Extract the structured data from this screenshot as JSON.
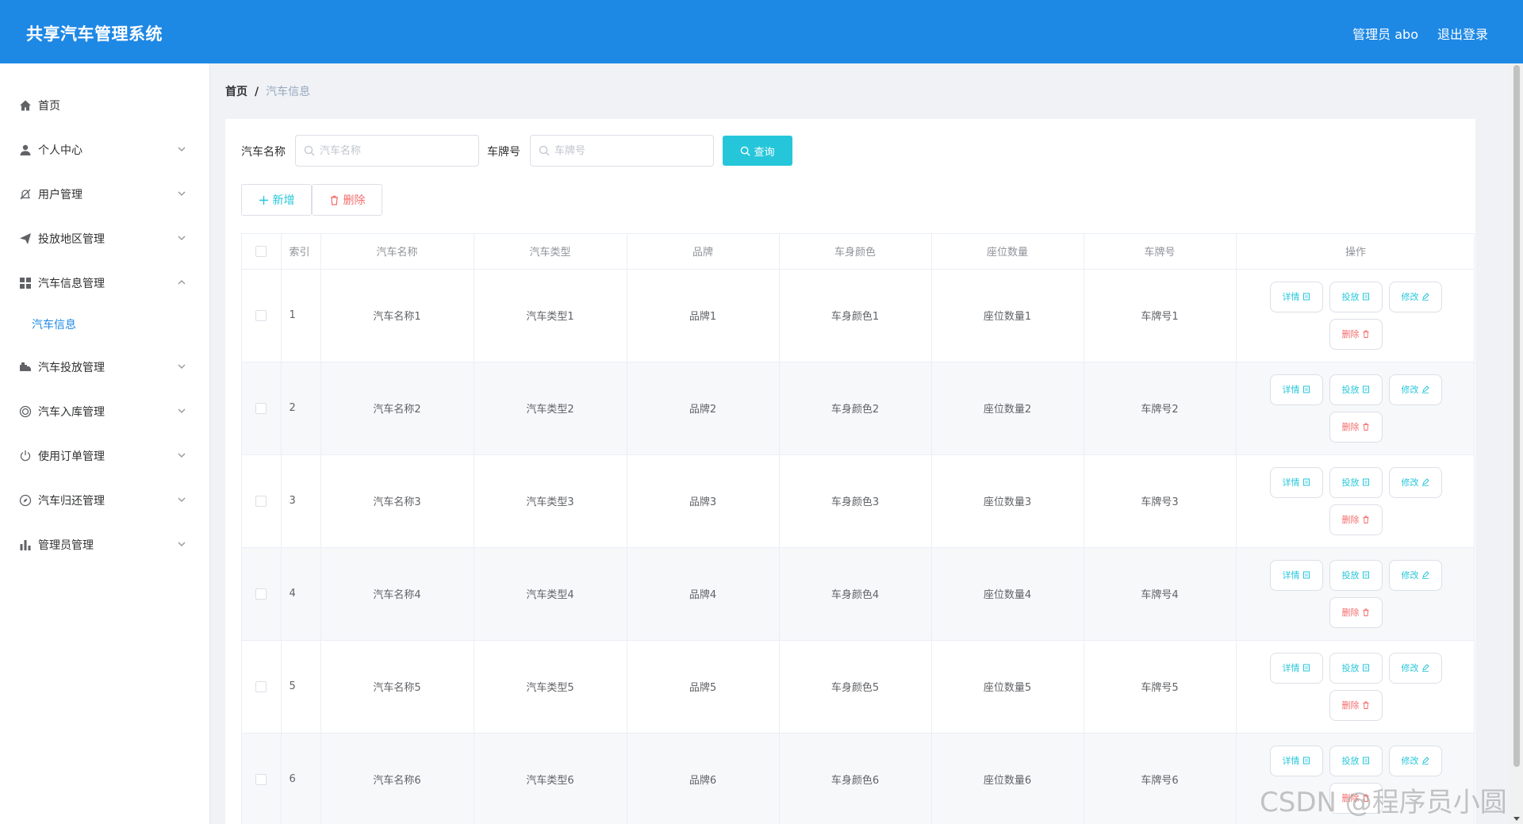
{
  "header": {
    "title": "共享汽车管理系统",
    "user": "管理员 abo",
    "logout": "退出登录"
  },
  "sidebar": {
    "items": [
      {
        "label": "首页",
        "icon": "home-icon",
        "expandable": false
      },
      {
        "label": "个人中心",
        "icon": "user-icon",
        "expandable": true
      },
      {
        "label": "用户管理",
        "icon": "bell-off-icon",
        "expandable": true
      },
      {
        "label": "投放地区管理",
        "icon": "send-icon",
        "expandable": true
      },
      {
        "label": "汽车信息管理",
        "icon": "grid-icon",
        "expandable": true,
        "expanded": true,
        "children": [
          "汽车信息"
        ]
      },
      {
        "label": "汽车投放管理",
        "icon": "truck-icon",
        "expandable": true
      },
      {
        "label": "汽车入库管理",
        "icon": "coin-icon",
        "expandable": true
      },
      {
        "label": "使用订单管理",
        "icon": "power-icon",
        "expandable": true
      },
      {
        "label": "汽车归还管理",
        "icon": "compass-icon",
        "expandable": true
      },
      {
        "label": "管理员管理",
        "icon": "bar-chart-icon",
        "expandable": true
      }
    ]
  },
  "breadcrumb": {
    "home": "首页",
    "separator": "/",
    "current": "汽车信息"
  },
  "search": {
    "name_label": "汽车名称",
    "name_placeholder": "汽车名称",
    "plate_label": "车牌号",
    "plate_placeholder": "车牌号",
    "query_button": "查询"
  },
  "toolbar": {
    "add_label": "新增",
    "delete_label": "删除"
  },
  "table": {
    "columns": [
      "索引",
      "汽车名称",
      "汽车类型",
      "品牌",
      "车身颜色",
      "座位数量",
      "车牌号",
      "操作"
    ],
    "actions": {
      "detail": "详情",
      "deploy": "投放",
      "edit": "修改",
      "delete": "删除"
    },
    "rows": [
      {
        "index": "1",
        "name": "汽车名称1",
        "type": "汽车类型1",
        "brand": "品牌1",
        "color": "车身颜色1",
        "seats": "座位数量1",
        "plate": "车牌号1"
      },
      {
        "index": "2",
        "name": "汽车名称2",
        "type": "汽车类型2",
        "brand": "品牌2",
        "color": "车身颜色2",
        "seats": "座位数量2",
        "plate": "车牌号2"
      },
      {
        "index": "3",
        "name": "汽车名称3",
        "type": "汽车类型3",
        "brand": "品牌3",
        "color": "车身颜色3",
        "seats": "座位数量3",
        "plate": "车牌号3"
      },
      {
        "index": "4",
        "name": "汽车名称4",
        "type": "汽车类型4",
        "brand": "品牌4",
        "color": "车身颜色4",
        "seats": "座位数量4",
        "plate": "车牌号4"
      },
      {
        "index": "5",
        "name": "汽车名称5",
        "type": "汽车类型5",
        "brand": "品牌5",
        "color": "车身颜色5",
        "seats": "座位数量5",
        "plate": "车牌号5"
      },
      {
        "index": "6",
        "name": "汽车名称6",
        "type": "汽车类型6",
        "brand": "品牌6",
        "color": "车身颜色6",
        "seats": "座位数量6",
        "plate": "车牌号6"
      }
    ]
  },
  "watermark": "CSDN @程序员小圆",
  "colors": {
    "header": "#1e88e5",
    "accent": "#26c6da",
    "danger": "#f56c6c",
    "active_menu": "#1e88e5"
  }
}
